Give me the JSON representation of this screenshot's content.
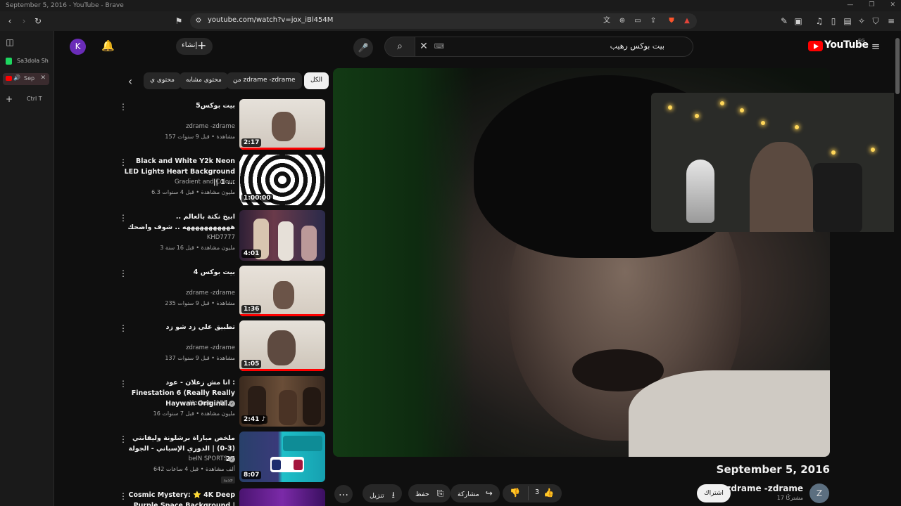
{
  "os": {
    "window_title": "September 5, 2016 - YouTube - Brave"
  },
  "browser": {
    "url": "youtube.com/watch?v=jox_iBl454M",
    "side_tabs": [
      {
        "label": "Sa3dola Sh"
      },
      {
        "label": "Sep"
      }
    ],
    "new_tab_hint": "Ctrl T"
  },
  "youtube": {
    "logo_text": "YouTube",
    "country_code": "EG",
    "search_query": "بيت بوكس رهيب",
    "create_label": "إنشاء",
    "account_initial": "K",
    "chips": [
      {
        "label": "الكل",
        "active": true
      },
      {
        "label": "من zdrame -zdrame",
        "active": false
      },
      {
        "label": "محتوى مشابه",
        "active": false
      },
      {
        "label": "محتوى ي",
        "active": false
      }
    ],
    "recommendations": [
      {
        "title": "بيت بوكس5",
        "channel": "zdrame -zdrame",
        "meta": "157 مشاهدة • قبل 9 سنوات",
        "duration": "2:17",
        "verified": false,
        "new": false
      },
      {
        "title": "Black and White Y2k Neon LED Lights Heart Background || 1 ...",
        "channel": "Gradient and Colour",
        "meta": "6.3 مليون مشاهدة • قبل 4 سنوات",
        "duration": "1:00:00",
        "verified": false,
        "new": false
      },
      {
        "title": "ابيخ نكتة بالعالم .. هههههههههههه .. شوف واضحك",
        "channel": "KHD7777",
        "meta": "3 مليون مشاهدة • قبل 16 سنة",
        "duration": "4:01",
        "verified": false,
        "new": false
      },
      {
        "title": "بيت بوكس 4",
        "channel": "zdrame -zdrame",
        "meta": "235 مشاهدة • قبل 9 سنوات",
        "duration": "1:36",
        "verified": false,
        "new": false
      },
      {
        "title": "تطبيق علي زد شو زد",
        "channel": "zdrame -zdrame",
        "meta": "137 مشاهدة • قبل 9 سنوات",
        "duration": "1:05",
        "verified": false,
        "new": false
      },
      {
        "title": "انا مش زعلان - عود : Finestation 6 (Really Really Haywan Original...",
        "channel": "Hesham Afifi",
        "meta": "16 مليون مشاهدة • قبل 7 سنوات",
        "duration": "2:41",
        "verified": true,
        "new": false
      },
      {
        "title": "ملخص مباراة برشلونة وليفانتي (3-0) | الدوري الإسباني - الجولة 25",
        "channel": "beIN SPORTS",
        "meta": "642 ألف مشاهدة • قبل 4 ساعات",
        "duration": "8:07",
        "verified": true,
        "new": true,
        "new_label": "جديد"
      },
      {
        "title": "Cosmic Mystery: ⭐ 4K Deep Purple Space Background |",
        "channel": "",
        "meta": "",
        "duration": "",
        "verified": false,
        "new": false
      }
    ],
    "video": {
      "date_title": "September 5, 2016",
      "channel_name": "zdrame -zdrame",
      "channel_initial": "Z",
      "subscribers": "17 مشتركًا",
      "subscribe_label": "اشتراك",
      "like_count": "3",
      "share_label": "مشاركة",
      "save_label": "حفظ",
      "download_label": "تنزيل"
    }
  }
}
